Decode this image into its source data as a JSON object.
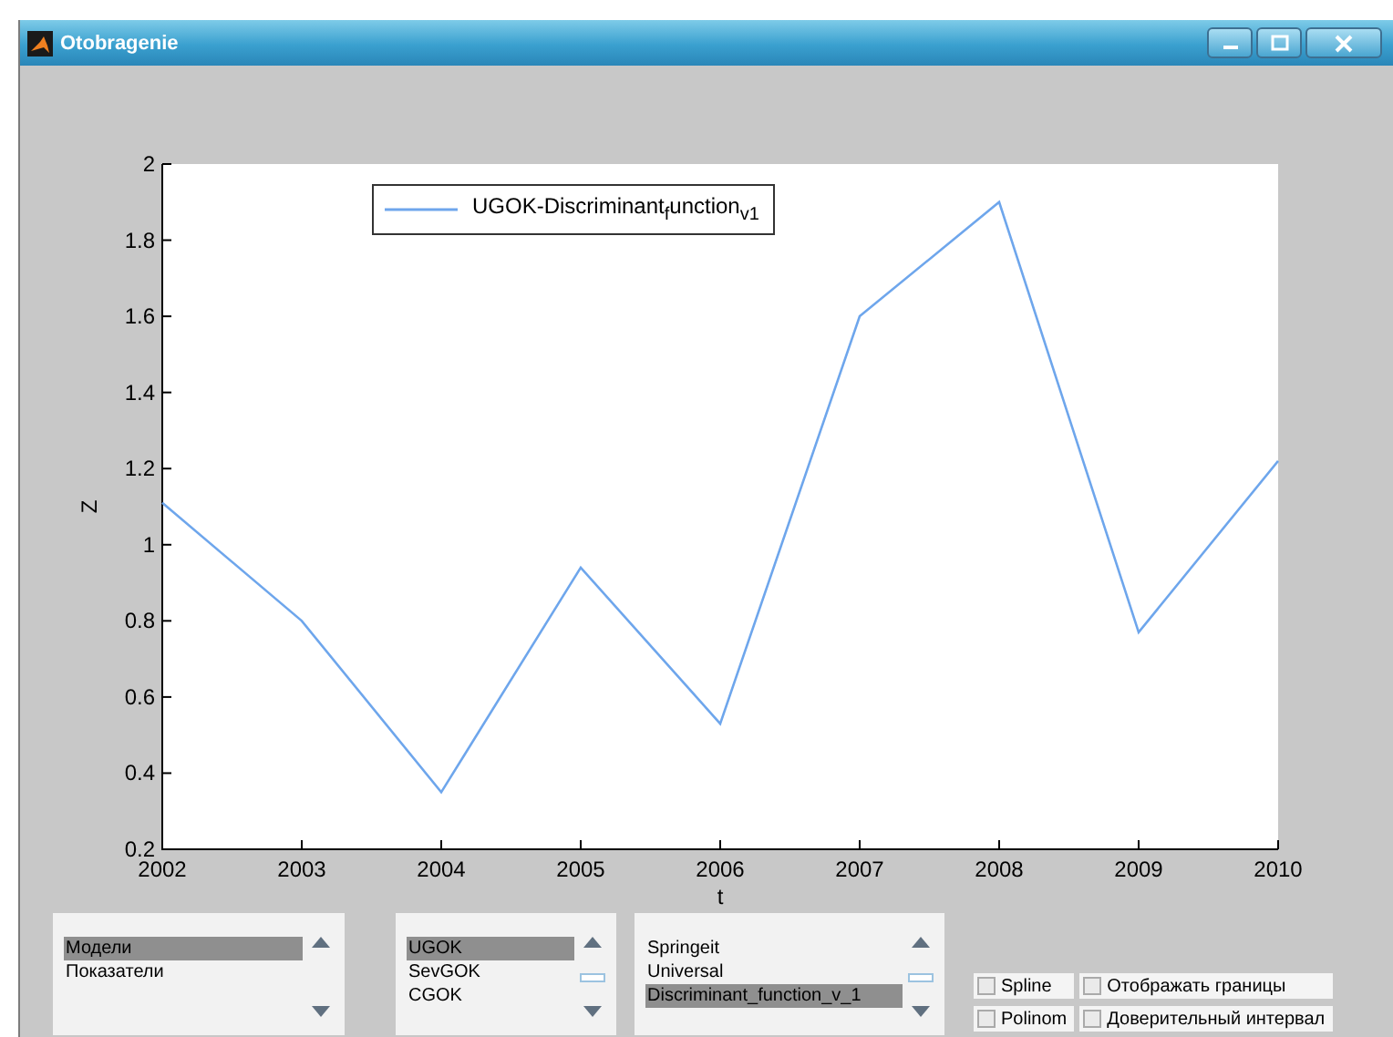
{
  "window": {
    "title": "Otobragenie"
  },
  "chart": {
    "chart_data": {
      "type": "line",
      "xlabel": "t",
      "ylabel": "Z",
      "x": [
        2002,
        2003,
        2004,
        2005,
        2006,
        2007,
        2008,
        2009,
        2010
      ],
      "series": [
        {
          "name": "UGOK-Discriminant$_{f}$unction$_{v1}$",
          "color": "#6ea6ec",
          "values": [
            1.11,
            0.8,
            0.35,
            0.94,
            0.53,
            1.6,
            1.9,
            0.77,
            1.22
          ]
        }
      ],
      "xlim": [
        2002,
        2010
      ],
      "ylim": [
        0.2,
        2
      ],
      "xticks": [
        2002,
        2003,
        2004,
        2005,
        2006,
        2007,
        2008,
        2009,
        2010
      ],
      "yticks": [
        0.2,
        0.4,
        0.6,
        0.8,
        {
          "value": 1,
          "label": "1"
        },
        1.2,
        1.4,
        1.6,
        1.8,
        {
          "value": 2,
          "label": "2"
        }
      ]
    }
  },
  "lists": [
    {
      "items": [
        {
          "label": "Модели",
          "selected": true
        },
        {
          "label": "Показатели",
          "selected": false
        }
      ]
    },
    {
      "items": [
        {
          "label": "UGOK",
          "selected": true
        },
        {
          "label": "SevGOK",
          "selected": false
        },
        {
          "label": "CGOK",
          "selected": false
        }
      ]
    },
    {
      "items": [
        {
          "label": "Springeit",
          "selected": false
        },
        {
          "label": "Universal",
          "selected": false
        },
        {
          "label": "Discriminant_function_v_1",
          "selected": true
        }
      ]
    }
  ],
  "options": [
    {
      "label": "Spline",
      "checked": false
    },
    {
      "label": "Отображать границы",
      "checked": false
    },
    {
      "label": "Polinom",
      "checked": false
    },
    {
      "label": "Доверительный интервал",
      "checked": false
    }
  ]
}
